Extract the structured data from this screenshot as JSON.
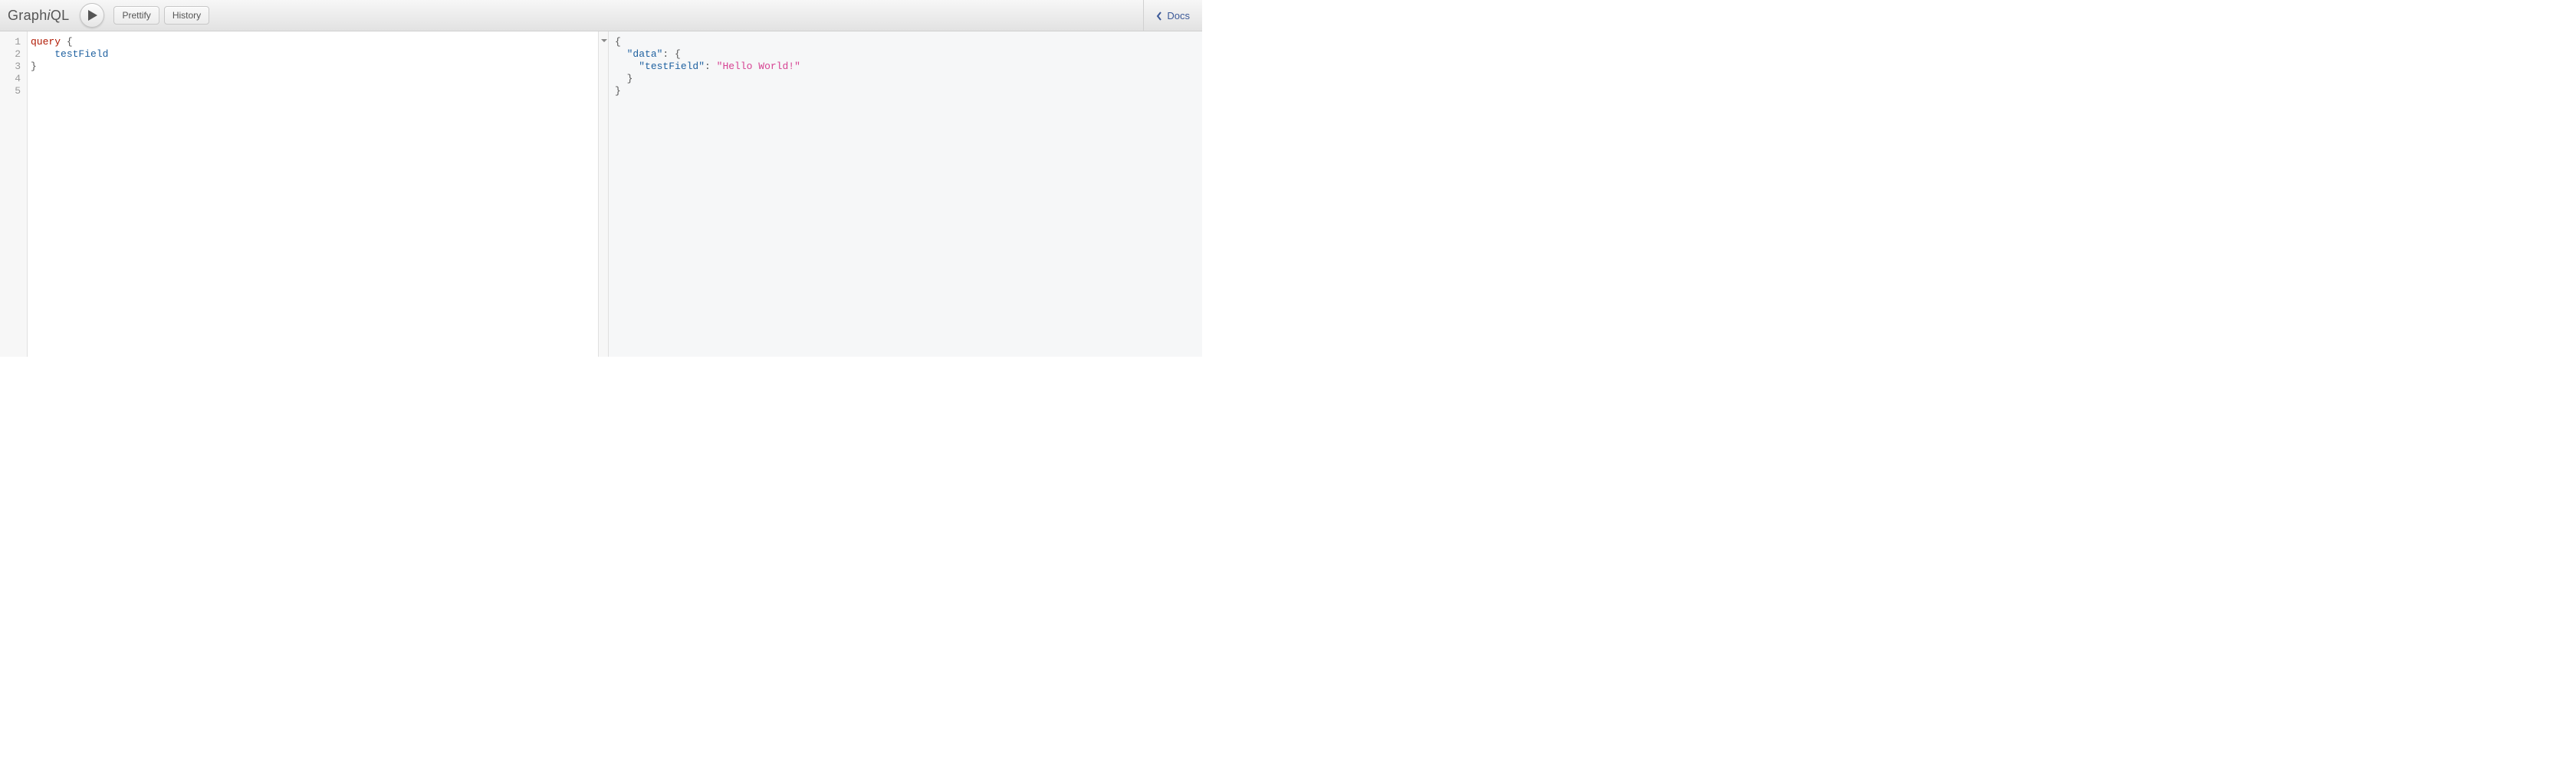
{
  "header": {
    "title_prefix": "Graph",
    "title_em": "i",
    "title_suffix": "QL",
    "prettify_label": "Prettify",
    "history_label": "History",
    "docs_label": "Docs"
  },
  "editor": {
    "gutter": [
      "1",
      "2",
      "3",
      "4",
      "5"
    ],
    "lines": [
      {
        "tokens": [
          {
            "t": "query",
            "c": "tok-keyword"
          },
          {
            "t": " ",
            "c": ""
          },
          {
            "t": "{",
            "c": "tok-punct"
          }
        ]
      },
      {
        "tokens": [
          {
            "t": "    ",
            "c": ""
          },
          {
            "t": "testField",
            "c": "tok-property"
          }
        ]
      },
      {
        "tokens": [
          {
            "t": "}",
            "c": "tok-punct"
          }
        ]
      },
      {
        "tokens": []
      },
      {
        "tokens": []
      }
    ]
  },
  "result": {
    "lines": [
      {
        "tokens": [
          {
            "t": "{",
            "c": "tok-punct"
          }
        ]
      },
      {
        "tokens": [
          {
            "t": "  ",
            "c": ""
          },
          {
            "t": "\"data\"",
            "c": "tok-key"
          },
          {
            "t": ": {",
            "c": "tok-punct"
          }
        ]
      },
      {
        "tokens": [
          {
            "t": "    ",
            "c": ""
          },
          {
            "t": "\"testField\"",
            "c": "tok-key"
          },
          {
            "t": ": ",
            "c": "tok-punct"
          },
          {
            "t": "\"Hello World!\"",
            "c": "tok-string"
          }
        ]
      },
      {
        "tokens": [
          {
            "t": "  }",
            "c": "tok-punct"
          }
        ]
      },
      {
        "tokens": [
          {
            "t": "}",
            "c": "tok-punct"
          }
        ]
      }
    ]
  }
}
